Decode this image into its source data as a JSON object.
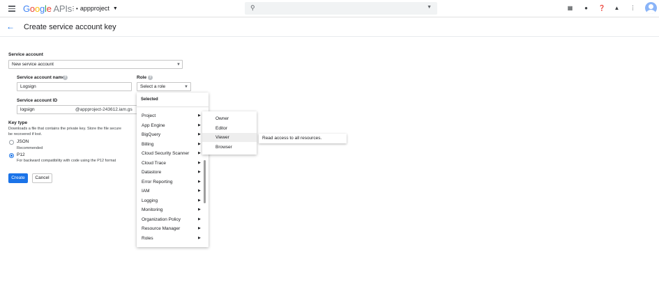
{
  "header": {
    "logo_google": "Google",
    "logo_apis": "APIs",
    "project_name": "appproject",
    "icons": [
      "menu-icon",
      "project-icon",
      "search-icon",
      "dropdown-icon",
      "gift-icon",
      "chat-icon",
      "help-icon",
      "notifications-icon",
      "more-vert-icon",
      "account-avatar"
    ]
  },
  "page": {
    "back_icon": "arrow-back-icon",
    "title": "Create service account key"
  },
  "form": {
    "service_account_label": "Service account",
    "service_account_value": "New service account",
    "service_account_name_label": "Service account name",
    "service_account_name_value": "Logsign",
    "role_label": "Role",
    "role_placeholder": "Select a role",
    "service_account_id_label": "Service account ID",
    "service_account_id_value": "logsign",
    "service_account_id_suffix": "@appproject-243612.iam.gs",
    "key_type_label": "Key type",
    "key_type_desc_line1": "Downloads a file that contains the private key. Store the file secure",
    "key_type_desc_line2": "be recovered if lost.",
    "options": [
      {
        "label": "JSON",
        "desc": "Recommended",
        "selected": false
      },
      {
        "label": "P12",
        "desc": "For backward compatibility with code using the P12 format",
        "selected": true
      }
    ],
    "create_button": "Create",
    "cancel_button": "Cancel"
  },
  "role_menu": {
    "header": "Selected",
    "items": [
      "Project",
      "App Engine",
      "BigQuery",
      "Billing",
      "Cloud Security Scanner",
      "Cloud Trace",
      "Datastore",
      "Error Reporting",
      "IAM",
      "Logging",
      "Monitoring",
      "Organization Policy",
      "Resource Manager",
      "Roles"
    ]
  },
  "project_submenu": {
    "items": [
      "Owner",
      "Editor",
      "Viewer",
      "Browser"
    ],
    "highlighted": "Viewer"
  },
  "tooltip": {
    "text": "Read access to all resources."
  },
  "colors": {
    "primary": "#1a73e8",
    "avatar": "#8ab4f8"
  }
}
